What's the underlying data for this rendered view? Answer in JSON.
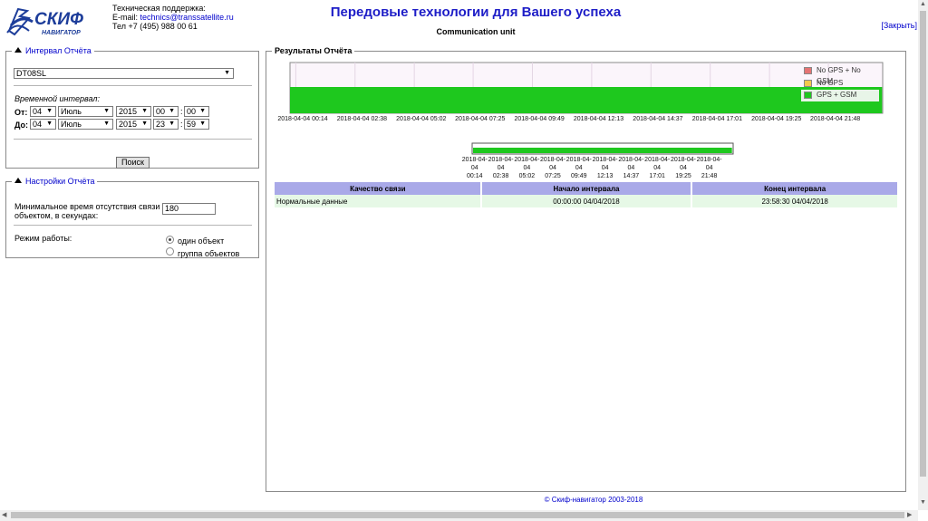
{
  "header": {
    "logo_text": "СКИФ",
    "logo_sub": "НАВИГАТОР",
    "support_title": "Техническая поддержка:",
    "email_label": "E-mail: ",
    "email": "technics@transsatellite.ru",
    "phone": "Тел +7 (495) 988 00 61",
    "slogan": "Передовые технологии для Вашего успеха",
    "unit_title": "Communication unit",
    "close_link": "[Закрыть]"
  },
  "interval_panel": {
    "legend": "Интервал Отчёта",
    "object": "DT08SL",
    "time_label": "Временной интервал:",
    "from_label": "От:",
    "to_label": "До:",
    "from": {
      "day": "04",
      "month": "Июль",
      "year": "2015",
      "hour": "00",
      "minute": "00"
    },
    "to": {
      "day": "04",
      "month": "Июль",
      "year": "2015",
      "hour": "23",
      "minute": "59"
    },
    "search_button": "Поиск"
  },
  "settings_panel": {
    "legend": "Настройки Отчёта",
    "min_time_label_1": "Минимальное время отсутствия связи с",
    "min_time_label_2": "объектом, в секундах:",
    "min_time_value": "180",
    "mode_label": "Режим работы:",
    "mode_single": "один объект",
    "mode_group": "группа объектов",
    "mode_selected": "single"
  },
  "results": {
    "legend": "Результаты Отчёта",
    "table_headers": [
      "Качество связи",
      "Начало интервала",
      "Конец интервала"
    ],
    "table_rows": [
      [
        "Нормальные данные",
        "00:00:00 04/04/2018",
        "23:58:30 04/04/2018"
      ]
    ]
  },
  "chart_data": {
    "type": "area",
    "time_ticks": [
      "2018-04-04 00:14",
      "2018-04-04 02:38",
      "2018-04-04 05:02",
      "2018-04-04 07:25",
      "2018-04-04 09:49",
      "2018-04-04 12:13",
      "2018-04-04 14:37",
      "2018-04-04 17:01",
      "2018-04-04 19:25",
      "2018-04-04 21:48"
    ],
    "mini_ticks": [
      {
        "date": "2018-04-04",
        "time": "00:14"
      },
      {
        "date": "2018-04-04",
        "time": "02:38"
      },
      {
        "date": "2018-04-04",
        "time": "05:02"
      },
      {
        "date": "2018-04-04",
        "time": "07:25"
      },
      {
        "date": "2018-04-04",
        "time": "09:49"
      },
      {
        "date": "2018-04-04",
        "time": "12:13"
      },
      {
        "date": "2018-04-04",
        "time": "14:37"
      },
      {
        "date": "2018-04-04",
        "time": "17:01"
      },
      {
        "date": "2018-04-04",
        "time": "19:25"
      },
      {
        "date": "2018-04-04",
        "time": "21:48"
      }
    ],
    "series": [
      {
        "name": "No GPS + No GSM",
        "color": "#e57373",
        "intervals": []
      },
      {
        "name": "No GPS",
        "color": "#f2c94c",
        "intervals": []
      },
      {
        "name": "GPS + GSM",
        "color": "#1ec81e",
        "intervals": [
          [
            "2018-04-04 00:00:00",
            "2018-04-04 23:58:30"
          ]
        ]
      }
    ],
    "legend_position": "top-right",
    "grid": true
  },
  "footer": "© Скиф-навигатор 2003-2018"
}
